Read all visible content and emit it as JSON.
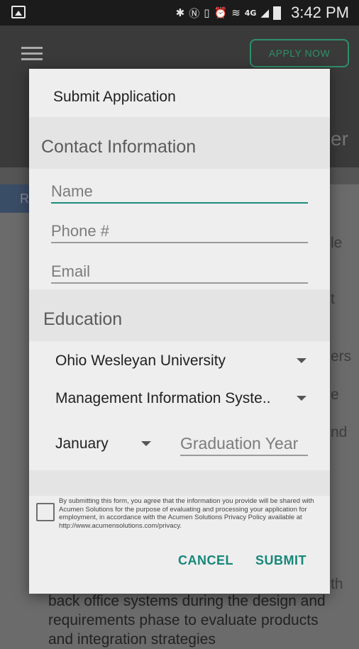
{
  "status_bar": {
    "time": "3:42 PM",
    "network_label": "4G"
  },
  "background": {
    "apply_label": "APPLY NOW",
    "header_fragment": "er",
    "tab_fragment": "R",
    "text_fragments": [
      "le",
      "t",
      "ers",
      "e",
      "nd"
    ],
    "bottom_lines": [
      "th",
      "back office systems during the design and",
      "requirements phase to evaluate products",
      "and integration strategies"
    ]
  },
  "dialog": {
    "title": "Submit Application",
    "contact": {
      "heading": "Contact Information",
      "name_placeholder": "Name",
      "phone_placeholder": "Phone #",
      "email_placeholder": "Email"
    },
    "education": {
      "heading": "Education",
      "university": "Ohio Wesleyan University",
      "major": "Management Information Syste..",
      "month": "January",
      "year_placeholder": "Graduation Year"
    },
    "consent_text": "By submitting this form, you agree that the information you provide will be shared with Acumen Solutions for the purpose of evaluating and processing your application for employment, in accordance with the Acumen Solutions Privacy Policy available at http://www.acumensolutions.com/privacy.",
    "cancel_label": "CANCEL",
    "submit_label": "SUBMIT"
  },
  "colors": {
    "accent": "#17877a",
    "apply_button": "#2f8f6a"
  }
}
